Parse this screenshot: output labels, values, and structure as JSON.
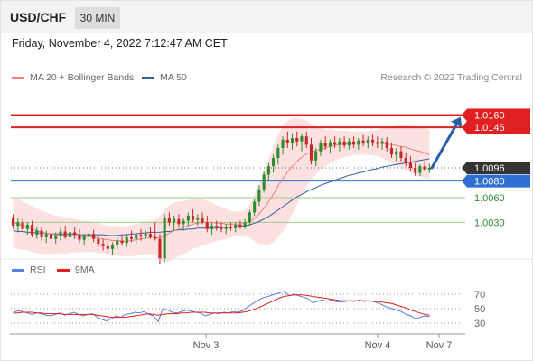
{
  "header": {
    "symbol": "USD/CHF",
    "timeframe": "30 MIN",
    "datetime": "Friday, November 4, 2022 7:12:47 AM CET"
  },
  "legend": {
    "ma20_label": "MA 20 + Bollinger Bands",
    "ma50_label": "MA 50",
    "credit": "Research © 2022 Trading Central",
    "rsi_label": "RSI",
    "rsi_ma_label": "9MA"
  },
  "colors": {
    "candle_up": "#2e8b2e",
    "candle_down": "#c62828",
    "ma20": "#f08080",
    "ma50": "#3a5f9f",
    "resistance": "#e02020",
    "support_current": "#2e6fd1",
    "support": "#9acd8a",
    "band_fill": "#fde0e0",
    "arrow": "#2a5fa8",
    "rsi": "#5b7fdc",
    "rsi_ma": "#e02020"
  },
  "chart_data": [
    {
      "type": "candlestick",
      "title": "",
      "x_ticks": [
        "Nov 3",
        "Nov 4",
        "Nov 7"
      ],
      "ylim": [
        0.999,
        1.019
      ],
      "current_price": 1.0096,
      "levels": [
        {
          "label": "1.0160",
          "value": 1.016,
          "kind": "resistance"
        },
        {
          "label": "1.0145",
          "value": 1.0145,
          "kind": "resistance"
        },
        {
          "label": "1.0096",
          "value": 1.0096,
          "kind": "current"
        },
        {
          "label": "1.0080",
          "value": 1.008,
          "kind": "pivot"
        },
        {
          "label": "1.0060",
          "value": 1.006,
          "kind": "support"
        },
        {
          "label": "1.0030",
          "value": 1.003,
          "kind": "support"
        }
      ],
      "arrow": {
        "from": 1.0096,
        "to": 1.015,
        "direction": "up"
      },
      "ohlc": [
        [
          1.0035,
          1.004,
          1.0022,
          1.0026
        ],
        [
          1.0026,
          1.0035,
          1.0018,
          1.003
        ],
        [
          1.003,
          1.0034,
          1.002,
          1.0022
        ],
        [
          1.0022,
          1.003,
          1.0015,
          1.0027
        ],
        [
          1.0027,
          1.0032,
          1.0012,
          1.0015
        ],
        [
          1.0015,
          1.0024,
          1.001,
          1.002
        ],
        [
          1.002,
          1.0025,
          1.0008,
          1.0012
        ],
        [
          1.0012,
          1.002,
          1.0005,
          1.0016
        ],
        [
          1.0016,
          1.0022,
          1.0006,
          1.001
        ],
        [
          1.001,
          1.0018,
          1.0004,
          1.0014
        ],
        [
          1.0014,
          1.0024,
          1.0008,
          1.0019
        ],
        [
          1.0019,
          1.0026,
          1.001,
          1.0012
        ],
        [
          1.0012,
          1.0022,
          1.0008,
          1.0018
        ],
        [
          1.0018,
          1.0024,
          1.001,
          1.0015
        ],
        [
          1.0015,
          1.0022,
          1.0005,
          1.0009
        ],
        [
          1.0009,
          1.0016,
          1.0002,
          1.0013
        ],
        [
          1.0013,
          1.002,
          1.0008,
          1.0016
        ],
        [
          1.0016,
          1.0021,
          1.0006,
          1.001
        ],
        [
          1.001,
          1.0015,
          1.0,
          1.0004
        ],
        [
          1.0004,
          1.001,
          0.9996,
          1.0001
        ],
        [
          1.0001,
          1.0008,
          0.9993,
          0.9998
        ],
        [
          0.9998,
          1.0006,
          0.999,
          1.0003
        ],
        [
          1.0003,
          1.0012,
          0.9998,
          1.0008
        ],
        [
          1.0008,
          1.0014,
          1.0002,
          1.0005
        ],
        [
          1.0005,
          1.0016,
          1.0,
          1.0012
        ],
        [
          1.0012,
          1.002,
          1.0006,
          1.001
        ],
        [
          1.001,
          1.0018,
          1.0004,
          1.0015
        ],
        [
          1.0015,
          1.0022,
          1.0008,
          1.0014
        ],
        [
          1.0014,
          1.002,
          1.001,
          1.0016
        ],
        [
          1.0016,
          1.0025,
          1.001,
          1.0012
        ],
        [
          1.0012,
          1.003,
          1.0008,
          1.001
        ],
        [
          1.001,
          1.0016,
          0.998,
          0.9985
        ],
        [
          0.9985,
          1.004,
          0.9982,
          1.0036
        ],
        [
          1.0036,
          1.0042,
          1.0026,
          1.003
        ],
        [
          1.003,
          1.0038,
          1.002,
          1.0034
        ],
        [
          1.0034,
          1.004,
          1.0024,
          1.0028
        ],
        [
          1.0028,
          1.0036,
          1.002,
          1.0032
        ],
        [
          1.0032,
          1.0042,
          1.0026,
          1.0038
        ],
        [
          1.0038,
          1.0046,
          1.003,
          1.0033
        ],
        [
          1.0033,
          1.004,
          1.0026,
          1.0035
        ],
        [
          1.0035,
          1.0042,
          1.0028,
          1.003
        ],
        [
          1.003,
          1.0038,
          1.0018,
          1.0022
        ],
        [
          1.0022,
          1.003,
          1.0015,
          1.0026
        ],
        [
          1.0026,
          1.0032,
          1.002,
          1.0024
        ],
        [
          1.0024,
          1.003,
          1.0018,
          1.0022
        ],
        [
          1.0022,
          1.0028,
          1.0016,
          1.0025
        ],
        [
          1.0025,
          1.003,
          1.002,
          1.0023
        ],
        [
          1.0023,
          1.003,
          1.0018,
          1.0027
        ],
        [
          1.0027,
          1.0032,
          1.0022,
          1.0025
        ],
        [
          1.0025,
          1.0034,
          1.0022,
          1.003
        ],
        [
          1.003,
          1.0045,
          1.0026,
          1.0042
        ],
        [
          1.0042,
          1.0058,
          1.0038,
          1.0055
        ],
        [
          1.0055,
          1.0075,
          1.005,
          1.007
        ],
        [
          1.007,
          1.0092,
          1.0066,
          1.0088
        ],
        [
          1.0088,
          1.0102,
          1.008,
          1.0098
        ],
        [
          1.0098,
          1.0112,
          1.009,
          1.0108
        ],
        [
          1.0108,
          1.0124,
          1.01,
          1.012
        ],
        [
          1.012,
          1.0134,
          1.0112,
          1.013
        ],
        [
          1.013,
          1.014,
          1.012,
          1.0126
        ],
        [
          1.0126,
          1.0138,
          1.0118,
          1.0132
        ],
        [
          1.0132,
          1.014,
          1.0122,
          1.0128
        ],
        [
          1.0128,
          1.0138,
          1.0116,
          1.0134
        ],
        [
          1.0134,
          1.014,
          1.012,
          1.0124
        ],
        [
          1.0124,
          1.0132,
          1.01,
          1.0105
        ],
        [
          1.0105,
          1.012,
          1.0098,
          1.0116
        ],
        [
          1.0116,
          1.013,
          1.011,
          1.0126
        ],
        [
          1.0126,
          1.0134,
          1.0118,
          1.0122
        ],
        [
          1.0122,
          1.013,
          1.0114,
          1.0127
        ],
        [
          1.0127,
          1.0134,
          1.012,
          1.0124
        ],
        [
          1.0124,
          1.0132,
          1.0116,
          1.0128
        ],
        [
          1.0128,
          1.0134,
          1.012,
          1.0123
        ],
        [
          1.0123,
          1.0132,
          1.0118,
          1.0128
        ],
        [
          1.0128,
          1.0134,
          1.012,
          1.0124
        ],
        [
          1.0124,
          1.0132,
          1.0118,
          1.0129
        ],
        [
          1.0129,
          1.0136,
          1.0122,
          1.0126
        ],
        [
          1.0126,
          1.0134,
          1.012,
          1.013
        ],
        [
          1.013,
          1.0136,
          1.0122,
          1.0127
        ],
        [
          1.0127,
          1.0134,
          1.012,
          1.0125
        ],
        [
          1.0125,
          1.0132,
          1.0118,
          1.0128
        ],
        [
          1.0128,
          1.0133,
          1.0116,
          1.012
        ],
        [
          1.012,
          1.0126,
          1.0108,
          1.0112
        ],
        [
          1.0112,
          1.012,
          1.0104,
          1.0116
        ],
        [
          1.0116,
          1.0122,
          1.0104,
          1.0108
        ],
        [
          1.0108,
          1.0114,
          1.0098,
          1.0102
        ],
        [
          1.0102,
          1.011,
          1.0092,
          1.0096
        ],
        [
          1.0096,
          1.0102,
          1.0086,
          1.009
        ],
        [
          1.009,
          1.01,
          1.0086,
          1.0098
        ],
        [
          1.0098,
          1.0104,
          1.0092,
          1.0094
        ],
        [
          1.0094,
          1.0101,
          1.009,
          1.0096
        ]
      ],
      "ma20": [
        1.003,
        1.0028,
        1.0026,
        1.0024,
        1.0022,
        1.002,
        1.0018,
        1.0017,
        1.0016,
        1.0015,
        1.0015,
        1.0014,
        1.0014,
        1.0014,
        1.0013,
        1.0013,
        1.0013,
        1.0012,
        1.0011,
        1.001,
        1.0009,
        1.0008,
        1.0008,
        1.0007,
        1.0007,
        1.0008,
        1.0009,
        1.001,
        1.0011,
        1.0012,
        1.0012,
        1.0011,
        1.0014,
        1.0017,
        1.002,
        1.0022,
        1.0024,
        1.0026,
        1.0028,
        1.0029,
        1.003,
        1.003,
        1.003,
        1.0029,
        1.0029,
        1.0028,
        1.0028,
        1.0028,
        1.0028,
        1.0029,
        1.0031,
        1.0035,
        1.004,
        1.0047,
        1.0055,
        1.0064,
        1.0074,
        1.0083,
        1.0091,
        1.0098,
        1.0104,
        1.0109,
        1.0113,
        1.0115,
        1.0117,
        1.0119,
        1.012,
        1.0122,
        1.0123,
        1.0124,
        1.0125,
        1.0125,
        1.0126,
        1.0126,
        1.0126,
        1.0126,
        1.0126,
        1.0126,
        1.0126,
        1.0125,
        1.0124,
        1.0123,
        1.0122,
        1.0121,
        1.0119,
        1.0117,
        1.0116,
        1.0114,
        1.0112
      ],
      "ma50": [
        1.002,
        1.0019,
        1.0019,
        1.0018,
        1.0018,
        1.0017,
        1.0017,
        1.0017,
        1.0016,
        1.0016,
        1.0016,
        1.0016,
        1.0016,
        1.0016,
        1.0015,
        1.0015,
        1.0015,
        1.0015,
        1.0015,
        1.0015,
        1.0014,
        1.0014,
        1.0014,
        1.0015,
        1.0015,
        1.0016,
        1.0016,
        1.0017,
        1.0017,
        1.0018,
        1.0018,
        1.0018,
        1.0019,
        1.0019,
        1.002,
        1.0021,
        1.0021,
        1.0022,
        1.0022,
        1.0023,
        1.0023,
        1.0023,
        1.0023,
        1.0023,
        1.0024,
        1.0024,
        1.0024,
        1.0025,
        1.0025,
        1.0026,
        1.0027,
        1.0029,
        1.0031,
        1.0034,
        1.0037,
        1.0041,
        1.0045,
        1.0049,
        1.0053,
        1.0057,
        1.0061,
        1.0064,
        1.0067,
        1.007,
        1.0072,
        1.0075,
        1.0077,
        1.0079,
        1.0081,
        1.0083,
        1.0085,
        1.0087,
        1.0088,
        1.009,
        1.0091,
        1.0093,
        1.0094,
        1.0095,
        1.0097,
        1.0098,
        1.0099,
        1.01,
        1.0101,
        1.0102,
        1.0103,
        1.0104,
        1.0105,
        1.0106,
        1.0107
      ],
      "bb_width": [
        0.003,
        0.003,
        0.0029,
        0.0028,
        0.0028,
        0.0027,
        0.0026,
        0.0025,
        0.0024,
        0.0023,
        0.0022,
        0.0022,
        0.0021,
        0.002,
        0.002,
        0.0019,
        0.0019,
        0.0018,
        0.0018,
        0.0017,
        0.0017,
        0.0017,
        0.0018,
        0.0018,
        0.0018,
        0.0019,
        0.0019,
        0.002,
        0.002,
        0.002,
        0.0021,
        0.0026,
        0.0032,
        0.0034,
        0.0034,
        0.0033,
        0.0032,
        0.0031,
        0.003,
        0.0029,
        0.0028,
        0.0026,
        0.0024,
        0.0022,
        0.002,
        0.0018,
        0.0016,
        0.0015,
        0.0015,
        0.0016,
        0.002,
        0.0028,
        0.0036,
        0.0044,
        0.0052,
        0.0058,
        0.0062,
        0.0064,
        0.0062,
        0.0058,
        0.0052,
        0.0046,
        0.004,
        0.0034,
        0.0029,
        0.0025,
        0.0022,
        0.002,
        0.0018,
        0.0017,
        0.0016,
        0.0015,
        0.0014,
        0.0014,
        0.0014,
        0.0014,
        0.0015,
        0.0016,
        0.0018,
        0.002,
        0.0022,
        0.0024,
        0.0026,
        0.0028,
        0.0029,
        0.003,
        0.003,
        0.003,
        0.003
      ]
    },
    {
      "type": "line",
      "title": "",
      "ylim": [
        20,
        80
      ],
      "ylabels": [
        "70",
        "50",
        "30"
      ],
      "series": [
        {
          "name": "RSI",
          "values": [
            45,
            47,
            46,
            44,
            42,
            44,
            43,
            41,
            40,
            42,
            44,
            41,
            43,
            45,
            42,
            40,
            42,
            43,
            38,
            35,
            33,
            36,
            40,
            38,
            42,
            43,
            45,
            44,
            46,
            42,
            40,
            32,
            50,
            48,
            45,
            44,
            46,
            48,
            47,
            45,
            44,
            40,
            42,
            44,
            43,
            45,
            44,
            46,
            45,
            47,
            52,
            56,
            60,
            64,
            66,
            68,
            70,
            72,
            74,
            68,
            70,
            68,
            66,
            64,
            58,
            60,
            62,
            60,
            62,
            60,
            59,
            60,
            61,
            60,
            62,
            60,
            61,
            60,
            58,
            55,
            52,
            50,
            48,
            46,
            42,
            40,
            36,
            38,
            40,
            39
          ]
        },
        {
          "name": "9MA",
          "values": [
            44,
            44,
            45,
            45,
            45,
            44,
            44,
            43,
            43,
            43,
            43,
            42,
            42,
            42,
            42,
            42,
            42,
            42,
            41,
            40,
            39,
            38,
            38,
            38,
            38,
            39,
            40,
            41,
            42,
            43,
            42,
            41,
            42,
            43,
            43,
            43,
            44,
            44,
            45,
            45,
            45,
            45,
            44,
            44,
            44,
            44,
            44,
            44,
            44,
            45,
            46,
            48,
            50,
            53,
            56,
            59,
            62,
            65,
            67,
            68,
            69,
            69,
            69,
            68,
            67,
            66,
            65,
            64,
            63,
            62,
            61,
            61,
            61,
            61,
            61,
            61,
            61,
            60,
            60,
            59,
            58,
            57,
            55,
            53,
            51,
            48,
            46,
            44,
            42,
            41
          ]
        }
      ]
    }
  ]
}
